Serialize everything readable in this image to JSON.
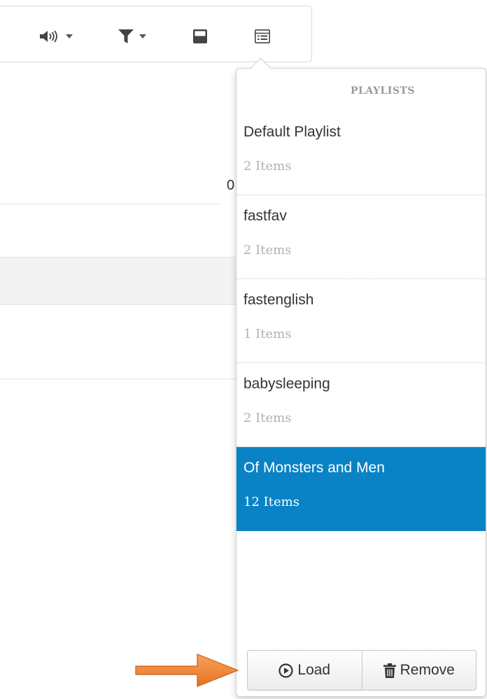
{
  "toolbar": {
    "buttons": [
      {
        "icon": "volume-icon",
        "has_caret": true
      },
      {
        "icon": "filter-icon",
        "has_caret": true
      },
      {
        "icon": "save-icon",
        "has_caret": false
      },
      {
        "icon": "playlist-icon",
        "has_caret": false
      }
    ]
  },
  "background": {
    "partial_text": "0"
  },
  "popover": {
    "title": "PLAYLISTS",
    "playlists": [
      {
        "name": "Default Playlist",
        "count": "2 Items",
        "selected": false
      },
      {
        "name": "fastfav",
        "count": "2 Items",
        "selected": false
      },
      {
        "name": "fastenglish",
        "count": "1 Items",
        "selected": false
      },
      {
        "name": "babysleeping",
        "count": "2 Items",
        "selected": false
      },
      {
        "name": "Of Monsters and Men",
        "count": "12 Items",
        "selected": true
      }
    ],
    "buttons": {
      "load_label": "Load",
      "load_icon": "play-circle-icon",
      "remove_label": "Remove",
      "remove_icon": "trash-icon"
    }
  },
  "colors": {
    "selected_bg": "#0a82c6",
    "annotation_arrow": "#f07f2d",
    "muted_text": "#b2b2b2"
  }
}
